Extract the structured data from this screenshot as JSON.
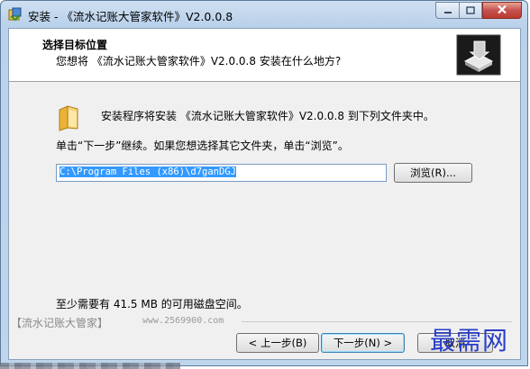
{
  "window": {
    "title": "安装 - 《流水记账大管家软件》V2.0.0.8"
  },
  "header": {
    "title": "选择目标位置",
    "subtitle": "您想将 《流水记账大管家软件》V2.0.0.8 安装在什么地方?"
  },
  "body": {
    "install_info": "安装程序将安装 《流水记账大管家软件》V2.0.0.8 到下列文件夹中。",
    "instruction": "单击“下一步”继续。如果您想选择其它文件夹，单击“浏览”。",
    "path_value": "C:\\Program Files (x86)\\d7ganDGJ",
    "browse_label": "浏览(R)...",
    "space_required": "至少需要有 41.5 MB 的可用磁盘空间。"
  },
  "brand": {
    "name": "【流水记账大管家】",
    "url": "www.2569900.com"
  },
  "footer": {
    "back_label": "< 上一步(B)",
    "next_label": "下一步(N) >",
    "cancel_label": "取消"
  },
  "watermark": "最需网",
  "icons": {
    "app": "installer-icon",
    "minimize": "minimize-icon",
    "maximize": "maximize-icon",
    "close": "close-icon",
    "header_logo": "setup-box-icon",
    "folder": "folder-icon"
  },
  "colors": {
    "selection": "#3399ff",
    "close_button": "#c75050",
    "watermark": "#2a3fc7"
  }
}
